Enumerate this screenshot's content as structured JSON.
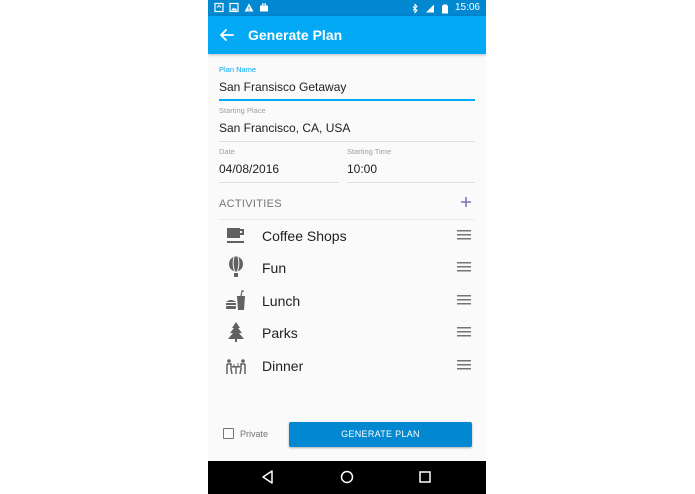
{
  "status_bar": {
    "time": "15:06",
    "left_icons": [
      "tasker-icon",
      "image-icon",
      "warning-icon",
      "briefcase-icon"
    ],
    "right_icons": [
      "bluetooth-icon",
      "signal-icon",
      "battery-icon"
    ]
  },
  "app_bar": {
    "title": "Generate Plan",
    "back_icon": "arrow-back-icon"
  },
  "form": {
    "plan_name": {
      "label": "Plan Name",
      "value": "San Fransisco Getaway"
    },
    "starting_place": {
      "label": "Starting Place",
      "value": "San Francisco, CA, USA"
    },
    "date": {
      "label": "Date",
      "value": "04/08/2016"
    },
    "starting_time": {
      "label": "Starting Time",
      "value": "10:00"
    }
  },
  "activities": {
    "title": "ACTIVITIES",
    "add_icon": "plus-icon",
    "items": [
      {
        "label": "Coffee Shops",
        "icon": "coffee-cup-icon"
      },
      {
        "label": "Fun",
        "icon": "hot-air-balloon-icon"
      },
      {
        "label": "Lunch",
        "icon": "burger-drink-icon"
      },
      {
        "label": "Parks",
        "icon": "tree-icon"
      },
      {
        "label": "Dinner",
        "icon": "dining-table-icon"
      }
    ]
  },
  "footer": {
    "private_label": "Private",
    "private_checked": false,
    "generate_label": "GENERATE PLAN"
  },
  "colors": {
    "primary": "#03a9f4",
    "primary_dark": "#0288d1",
    "text": "#212121",
    "secondary_text": "#757575"
  },
  "nav_bar": [
    "back-triangle-icon",
    "home-circle-icon",
    "recents-square-icon"
  ]
}
